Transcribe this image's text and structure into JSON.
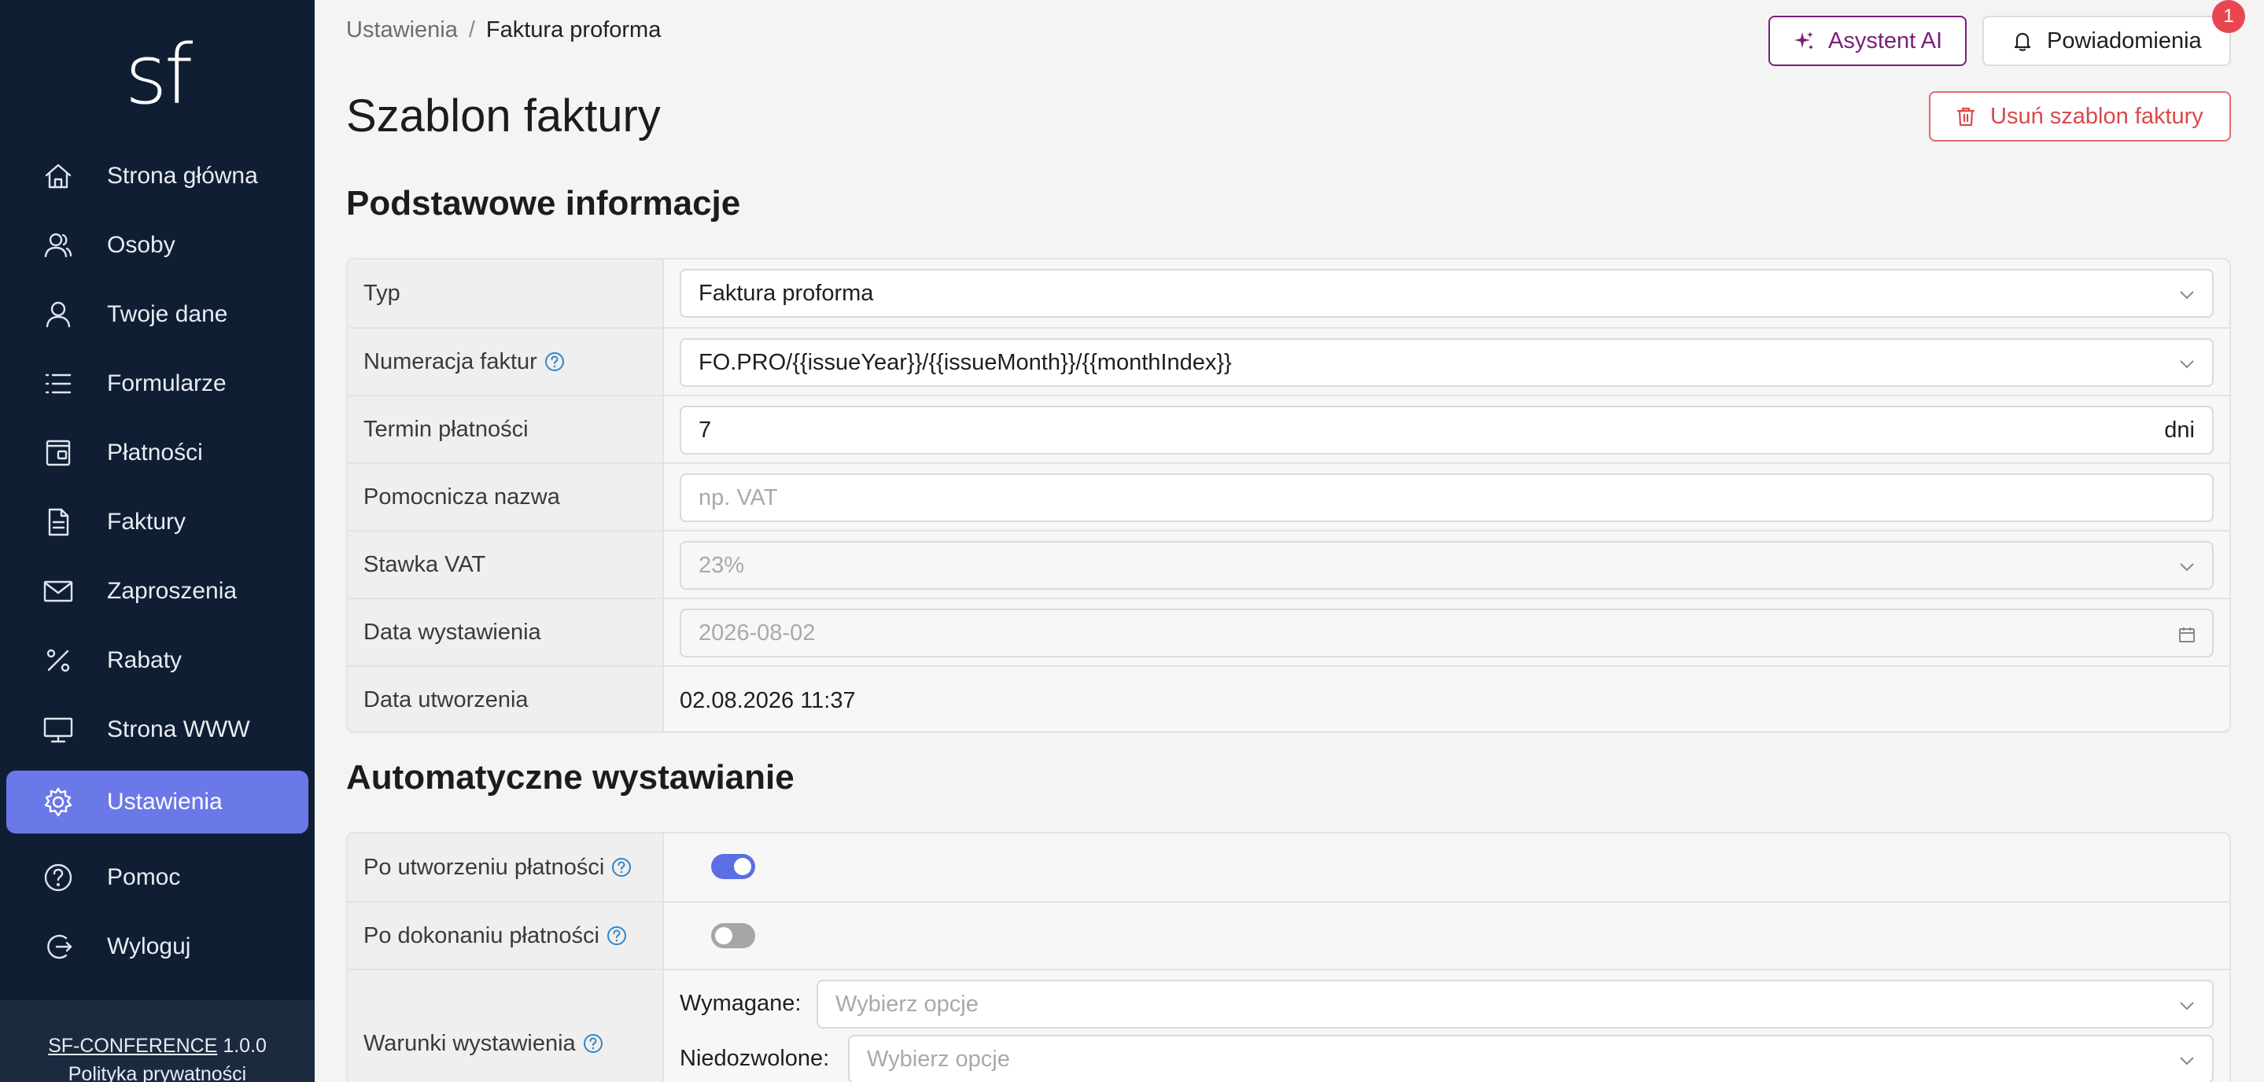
{
  "sidebar": {
    "logo": "sf",
    "items": [
      {
        "label": "Strona główna",
        "icon": "home-icon"
      },
      {
        "label": "Osoby",
        "icon": "people-icon"
      },
      {
        "label": "Twoje dane",
        "icon": "user-icon"
      },
      {
        "label": "Formularze",
        "icon": "list-icon"
      },
      {
        "label": "Płatności",
        "icon": "wallet-icon"
      },
      {
        "label": "Faktury",
        "icon": "document-icon"
      },
      {
        "label": "Zaproszenia",
        "icon": "envelope-icon"
      },
      {
        "label": "Rabaty",
        "icon": "percent-icon"
      },
      {
        "label": "Strona WWW",
        "icon": "monitor-icon"
      },
      {
        "label": "Ustawienia",
        "icon": "gear-icon",
        "active": true
      },
      {
        "label": "Pomoc",
        "icon": "help-circle-icon"
      },
      {
        "label": "Wyloguj",
        "icon": "logout-icon"
      }
    ],
    "footer": {
      "app_name": "SF-CONFERENCE",
      "version": "1.0.0",
      "privacy": "Polityka prywatności"
    }
  },
  "breadcrumb": {
    "parent": "Ustawienia",
    "separator": "/",
    "current": "Faktura proforma"
  },
  "header": {
    "ai_label": "Asystent AI",
    "notifications_label": "Powiadomienia",
    "notifications_count": "1",
    "delete_label": "Usuń szablon faktury"
  },
  "page_title": "Szablon faktury",
  "basic": {
    "title": "Podstawowe informacje",
    "type_label": "Typ",
    "type_value": "Faktura proforma",
    "numbering_label": "Numeracja faktur",
    "numbering_value": "FO.PRO/{{issueYear}}/{{issueMonth}}/{{monthIndex}}",
    "term_label": "Termin płatności",
    "term_value": "7",
    "term_unit": "dni",
    "aux_name_label": "Pomocnicza nazwa",
    "aux_name_placeholder": "np. VAT",
    "vat_label": "Stawka VAT",
    "vat_value": "23%",
    "issue_date_label": "Data wystawienia",
    "issue_date_value": "2026-08-02",
    "created_label": "Data utworzenia",
    "created_value": "02.08.2026 11:37"
  },
  "auto": {
    "title": "Automatyczne wystawianie",
    "after_create_label": "Po utworzeniu płatności",
    "after_create_on": true,
    "after_pay_label": "Po dokonaniu płatności",
    "after_pay_on": false,
    "conditions_label": "Warunki wystawienia",
    "required_label": "Wymagane:",
    "required_placeholder": "Wybierz opcje",
    "forbidden_label": "Niedozwolone:",
    "forbidden_placeholder": "Wybierz opcje"
  },
  "colors": {
    "sidebar_bg": "#0f1e33",
    "accent": "#6a78e8",
    "ai_purple": "#7a1e7a",
    "danger": "#d84a4a",
    "help_blue": "#2f86c9"
  }
}
